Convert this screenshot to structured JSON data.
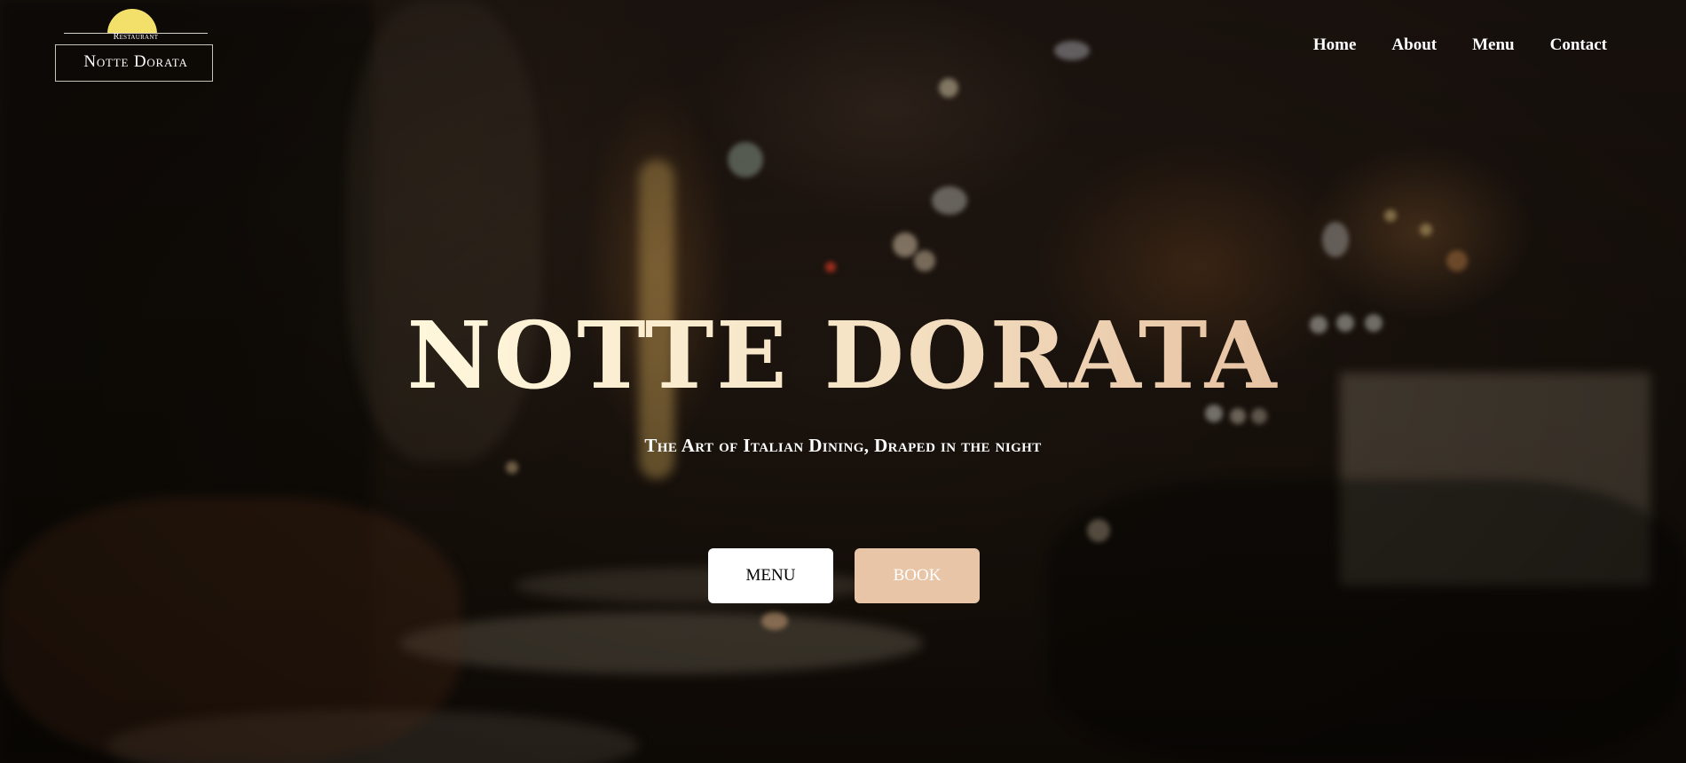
{
  "logo": {
    "small_text": "Restaurant",
    "name": "Notte Dorata",
    "sun_color": "#f2e06a"
  },
  "nav": {
    "items": [
      {
        "label": "Home"
      },
      {
        "label": "About"
      },
      {
        "label": "Menu"
      },
      {
        "label": "Contact"
      }
    ]
  },
  "hero": {
    "title": "NOTTE DORATA",
    "subtitle": "The Art of Italian Dining, Draped in the night",
    "buttons": {
      "menu_label": "MENU",
      "book_label": "BOOK"
    }
  },
  "colors": {
    "accent": "#e8c5a6",
    "title_gradient_start": "#fff7d9",
    "title_gradient_end": "#e6c2a2"
  }
}
